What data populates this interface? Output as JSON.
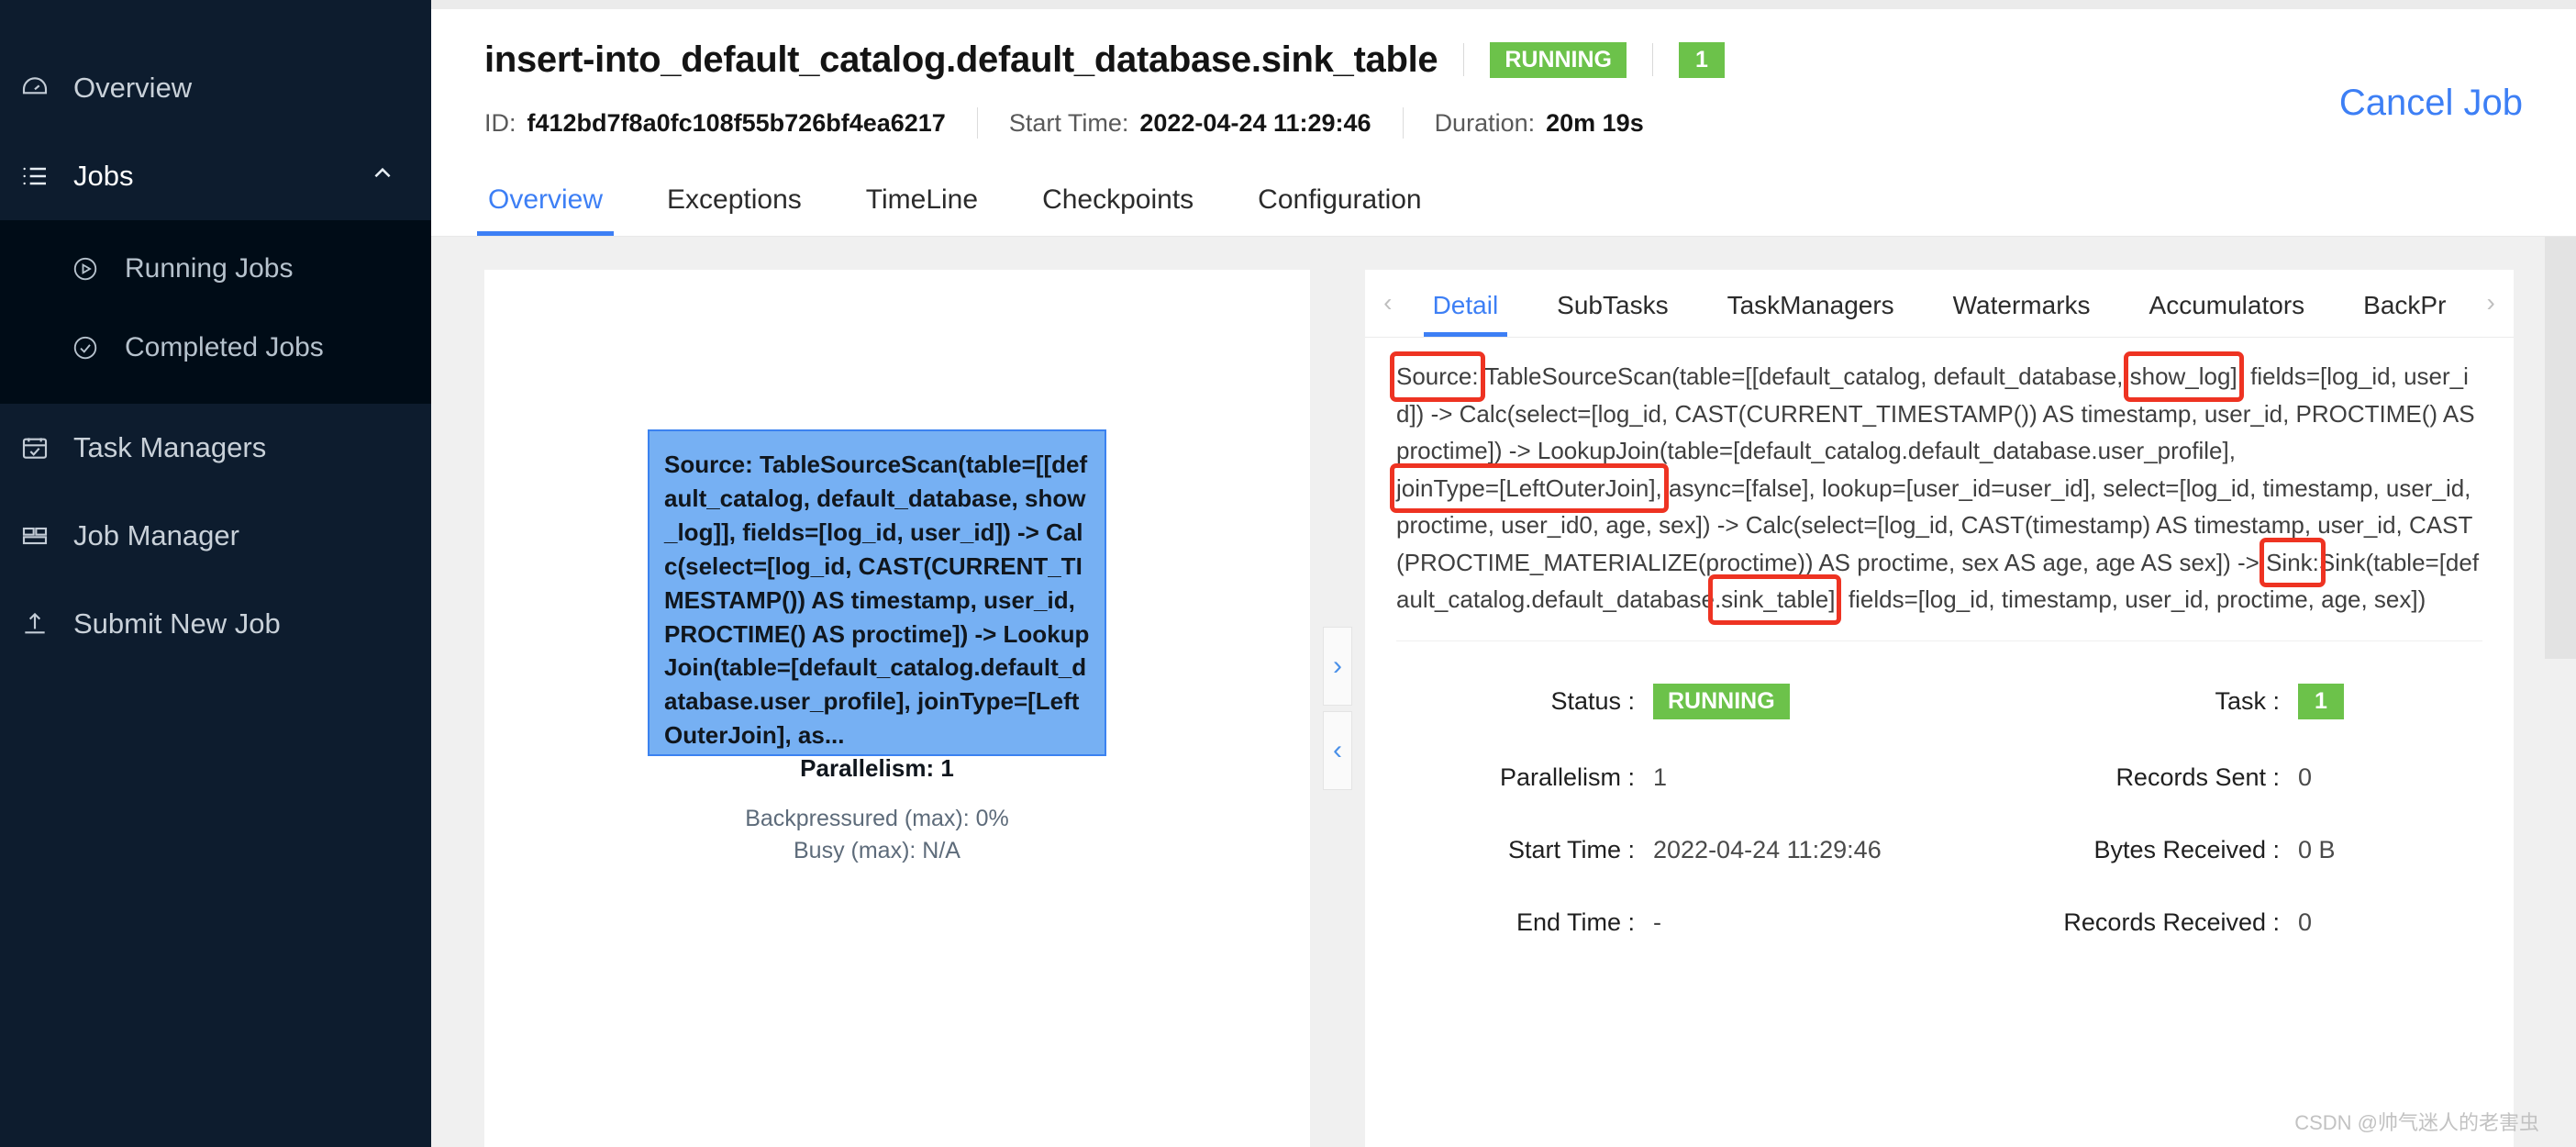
{
  "sidebar": {
    "items": [
      {
        "label": "Overview",
        "icon": "dashboard-icon",
        "key": "overview"
      },
      {
        "label": "Jobs",
        "icon": "list-icon",
        "key": "jobs",
        "expanded": true,
        "caret": "chevron-up-icon"
      },
      {
        "label": "Task Managers",
        "icon": "calendar-check-icon",
        "key": "task-managers"
      },
      {
        "label": "Job Manager",
        "icon": "layout-icon",
        "key": "job-manager"
      },
      {
        "label": "Submit New Job",
        "icon": "upload-icon",
        "key": "submit-new-job"
      }
    ],
    "sub_items": [
      {
        "label": "Running Jobs",
        "icon": "play-circle-icon",
        "key": "running-jobs"
      },
      {
        "label": "Completed Jobs",
        "icon": "check-circle-icon",
        "key": "completed-jobs"
      }
    ]
  },
  "header": {
    "job_title": "insert-into_default_catalog.default_database.sink_table",
    "status_badge": "RUNNING",
    "task_badge": "1",
    "cancel_label": "Cancel Job",
    "id_label": "ID:",
    "id_value": "f412bd7f8a0fc108f55b726bf4ea6217",
    "start_time_label": "Start Time:",
    "start_time_value": "2022-04-24 11:29:46",
    "duration_label": "Duration:",
    "duration_value": "20m 19s"
  },
  "tabs": [
    {
      "label": "Overview",
      "active": true
    },
    {
      "label": "Exceptions",
      "active": false
    },
    {
      "label": "TimeLine",
      "active": false
    },
    {
      "label": "Checkpoints",
      "active": false
    },
    {
      "label": "Configuration",
      "active": false
    }
  ],
  "graph": {
    "node": {
      "description": "Source: TableSourceScan(table=[[default_catalog, default_database, show_log]], fields=[log_id, user_id]) -> Calc(select=[log_id, CAST(CURRENT_TIMESTAMP()) AS timestamp, user_id, PROCTIME() AS proctime]) -> LookupJoin(table=[default_catalog.default_database.user_profile], joinType=[LeftOuterJoin], as...",
      "parallelism": "Parallelism: 1",
      "backpressured": "Backpressured (max): 0%",
      "busy": "Busy (max): N/A"
    },
    "toggle_expand": "chevron-right-icon",
    "toggle_collapse": "chevron-left-icon"
  },
  "subtabs": {
    "prev_arrow": "chevron-left-icon",
    "next_arrow": "chevron-right-icon",
    "items": [
      {
        "label": "Detail",
        "active": true
      },
      {
        "label": "SubTasks",
        "active": false
      },
      {
        "label": "TaskManagers",
        "active": false
      },
      {
        "label": "Watermarks",
        "active": false
      },
      {
        "label": "Accumulators",
        "active": false
      },
      {
        "label": "BackPr",
        "active": false
      }
    ]
  },
  "detail": {
    "plan_parts": {
      "p1_source_label": "Source:",
      "p2": " TableSourceScan(table=[[default_catalog, default_database, ",
      "p3_show_log": "show_log]",
      "p4": ", fields=[log_id, user_id]) -> Calc(select=[log_id, CAST(CURRENT_TIMESTAMP()) AS timestamp, user_id, PROCTIME() AS proctime]) -> LookupJoin(table=[default_catalog.default_database.user_profile], ",
      "p5_jointype": "joinType=[LeftOuterJoin],",
      "p6": " async=[false], lookup=[user_id=user_id], select=[log_id, timestamp, user_id, proctime, user_id0, age, sex]) -> Calc(select=[log_id, CAST(timestamp) AS timestamp, user_id, CAST(PROCTIME_MATERIALIZE(proctime)) AS proctime, sex AS age, age AS sex]) -> ",
      "p7_sink_label": "Sink:",
      "p8": "Sink(table=[default_catalog.default_database",
      "p9_sink_table": ".sink_table]",
      "p10": ", fields=[log_id, timestamp, user_id, proctime, age, sex])"
    },
    "metrics": [
      {
        "left_key": "Status :",
        "left_value": "RUNNING",
        "left_is_badge": true,
        "right_key": "Task :",
        "right_value": "1",
        "right_is_badge": true
      },
      {
        "left_key": "Parallelism :",
        "left_value": "1",
        "left_is_badge": false,
        "right_key": "Records Sent :",
        "right_value": "0",
        "right_is_badge": false
      },
      {
        "left_key": "Start Time :",
        "left_value": "2022-04-24 11:29:46",
        "left_is_badge": false,
        "right_key": "Bytes Received :",
        "right_value": "0 B",
        "right_is_badge": false
      },
      {
        "left_key": "End Time :",
        "left_value": "-",
        "left_is_badge": false,
        "right_key": "Records Received :",
        "right_value": "0",
        "right_is_badge": false
      }
    ]
  },
  "watermark": "CSDN @帅气迷人的老害虫",
  "colors": {
    "accent": "#3d7ff5",
    "status_green": "#6cc24a",
    "node_blue": "#76b0f3",
    "highlight_red": "#ee3322",
    "sidebar_bg": "#0d1c2e",
    "sidebar_sub_bg": "#000c17"
  }
}
